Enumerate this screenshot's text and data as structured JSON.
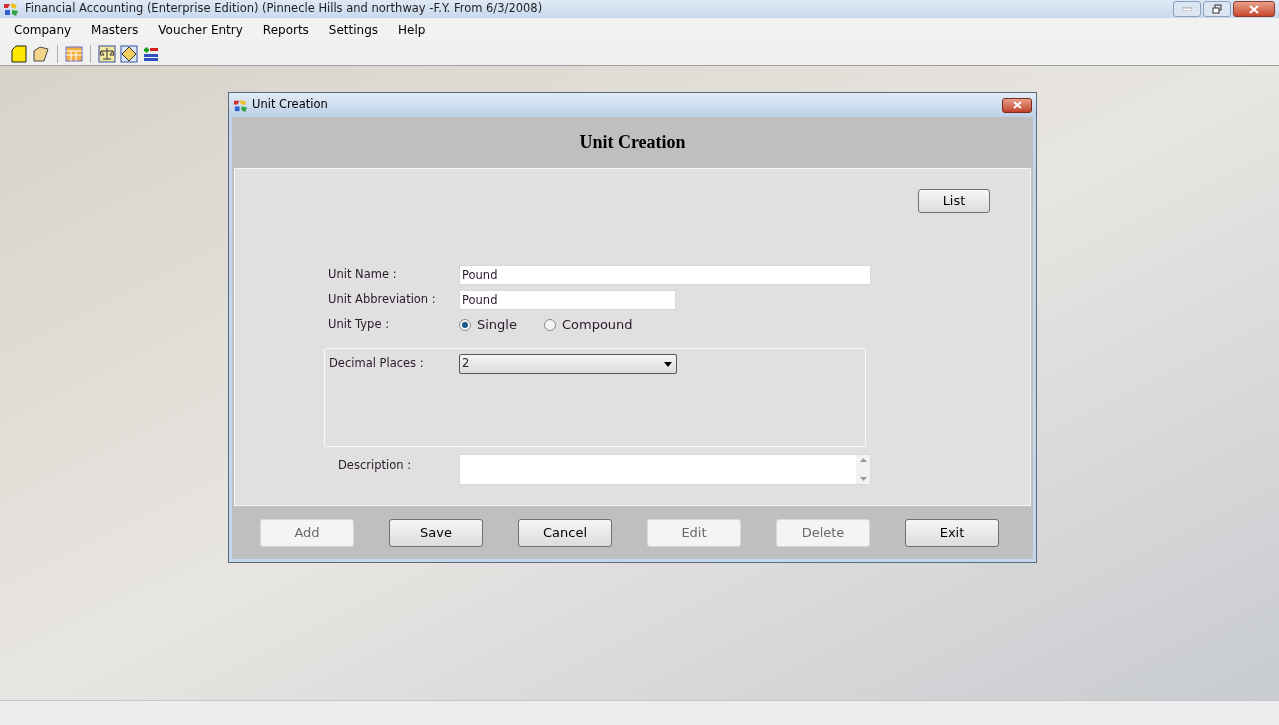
{
  "window": {
    "title": "Financial Accounting (Enterprise Edition) (Pinnecle Hills and northway -F.Y. From 6/3/2008)"
  },
  "menu": [
    "Company",
    "Masters",
    "Voucher Entry",
    "Reports",
    "Settings",
    "Help"
  ],
  "dialog": {
    "title": "Unit Creation",
    "heading": "Unit Creation",
    "list_button": "List",
    "unit_name": {
      "label": "Unit Name :",
      "value": "Pound"
    },
    "unit_abbreviation": {
      "label": "Unit Abbreviation :",
      "value": "Pound"
    },
    "unit_type": {
      "label": "Unit Type :",
      "options": [
        {
          "label": "Single",
          "selected": true
        },
        {
          "label": "Compound",
          "selected": false
        }
      ]
    },
    "decimal_places": {
      "label": "Decimal Places :",
      "value": "2"
    },
    "description": {
      "label": "Description :"
    },
    "buttons": [
      {
        "label": "Add",
        "disabled": true
      },
      {
        "label": "Save",
        "disabled": false
      },
      {
        "label": "Cancel",
        "disabled": false
      },
      {
        "label": "Edit",
        "disabled": true
      },
      {
        "label": "Delete",
        "disabled": true
      },
      {
        "label": "Exit",
        "disabled": false
      }
    ]
  }
}
